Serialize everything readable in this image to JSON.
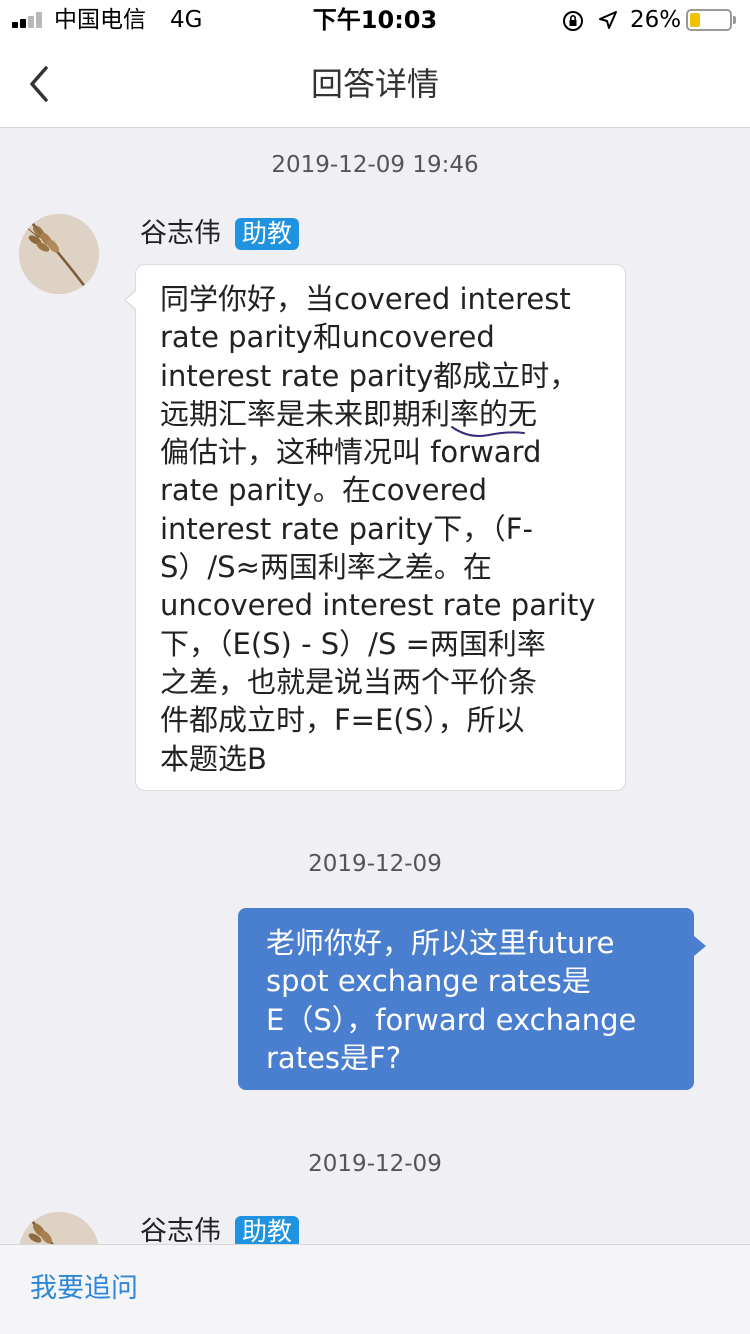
{
  "status_bar": {
    "carrier": "中国电信",
    "network": "4G",
    "time": "下午10:03",
    "battery_percent": "26%",
    "battery_level": 0.26,
    "icons": [
      "signal-icon",
      "orientation-lock-icon",
      "location-arrow-icon",
      "battery-icon"
    ],
    "battery_color": "#f2c200"
  },
  "nav": {
    "title": "回答详情"
  },
  "messages": [
    {
      "timestamp": "2019-12-09 19:46",
      "sender": "谷志伟",
      "badge": "助教",
      "lines": [
        "同学你好，当covered interest",
        "rate parity和uncovered",
        "interest rate parity都成立时，",
        "远期汇率是未来即期利率的无",
        "偏估计，这种情况叫 forward",
        "rate parity。在covered",
        "interest rate parity下，（F-",
        "S）/S≈两国利率之差。在",
        "uncovered interest rate parity",
        "下，（E(S) - S）/S =两国利率",
        "之差，也就是说当两个平价条",
        "件都成立时，F=E(S），所以",
        "本题选B"
      ]
    },
    {
      "timestamp": "2019-12-09",
      "sender": "me",
      "lines": [
        "老师你好，所以这里future",
        "spot exchange rates是",
        "E（S），forward exchange",
        "rates是F?"
      ]
    },
    {
      "timestamp": "2019-12-09",
      "sender": "谷志伟",
      "badge": "助教"
    }
  ],
  "bottom_bar": {
    "action_label": "我要追问"
  },
  "colors": {
    "accent": "#2c86d9",
    "badge": "#1f93e0",
    "outgoing_bubble": "#4a7fcf",
    "background": "#efeff4"
  }
}
